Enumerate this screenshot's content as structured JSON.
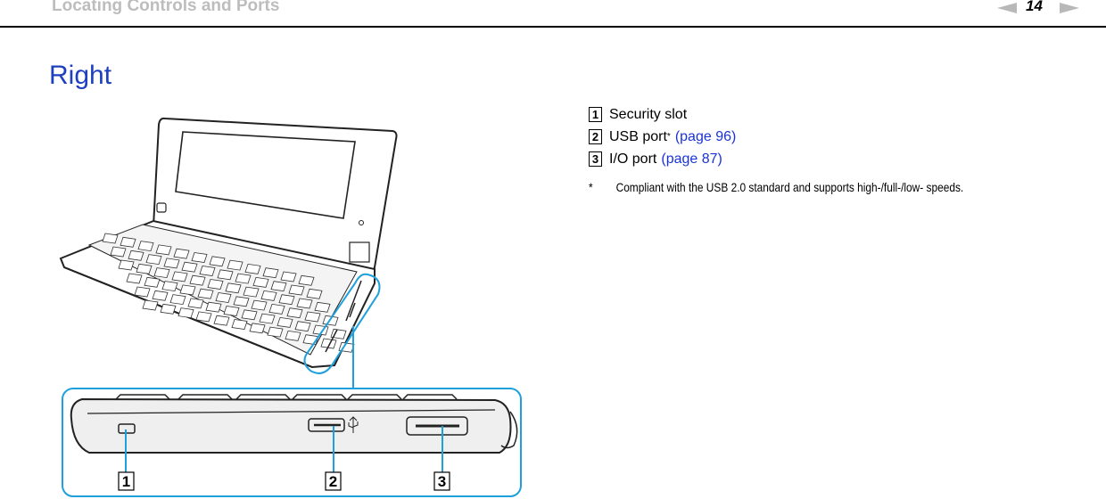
{
  "header": {
    "title": "Locating Controls and Ports",
    "page_number": "14",
    "prev_icon": "prev-page-arrow",
    "next_icon": "next-page-arrow"
  },
  "section": {
    "title": "Right"
  },
  "items": [
    {
      "number": "1",
      "label": "Security slot",
      "superscript": "",
      "link": ""
    },
    {
      "number": "2",
      "label": "USB port",
      "superscript": "*",
      "link": "(page 96)"
    },
    {
      "number": "3",
      "label": "I/O port",
      "superscript": "",
      "link": "(page 87)"
    }
  ],
  "footnote": {
    "marker": "*",
    "text": "Compliant with the USB 2.0 standard and supports high-/full-/low- speeds."
  },
  "illustration": {
    "callouts": [
      "1",
      "2",
      "3"
    ],
    "accent_color": "#1ea0dc"
  }
}
